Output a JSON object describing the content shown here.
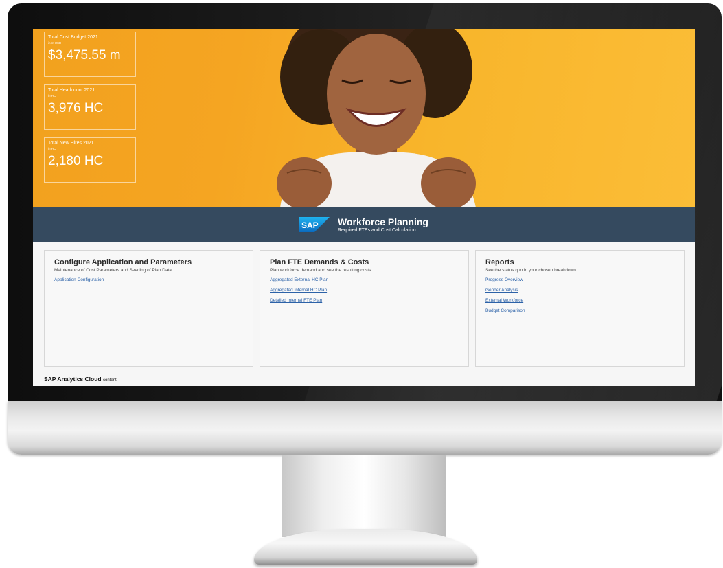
{
  "kpis": [
    {
      "title": "Total Cost Budget 2021",
      "unit": "in m USD",
      "value": "$3,475.55 m"
    },
    {
      "title": "Total Headcount 2021",
      "unit": "in HC",
      "value": "3,976 HC"
    },
    {
      "title": "Total New Hires 2021",
      "unit": "in HC",
      "value": "2,180 HC"
    }
  ],
  "banner": {
    "logo_text": "SAP",
    "title": "Workforce Planning",
    "subtitle": "Required FTEs and Cost Calculation"
  },
  "cards": [
    {
      "title": "Configure Application and Parameters",
      "description": "Maintenance of Cost Parameters and Seeding of Plan Data",
      "links": [
        "Application Configuration"
      ]
    },
    {
      "title": "Plan FTE Demands & Costs",
      "description": "Plan workforce demand and see the resulting costs",
      "links": [
        "Aggregated External HC Plan",
        "Aggregated Internal HC Plan",
        "Detailed Internal FTE Plan"
      ]
    },
    {
      "title": "Reports",
      "description": "See the status quo in your chosen breakdown",
      "links": [
        "Progress Overview",
        "Gender Analysis",
        "External Workforce",
        "Budget Comparison"
      ]
    }
  ],
  "footer": {
    "brand": "SAP Analytics Cloud",
    "suffix": "content"
  },
  "colors": {
    "hero": "#f5a522",
    "banner": "#354a5f",
    "link": "#2c62a8"
  }
}
